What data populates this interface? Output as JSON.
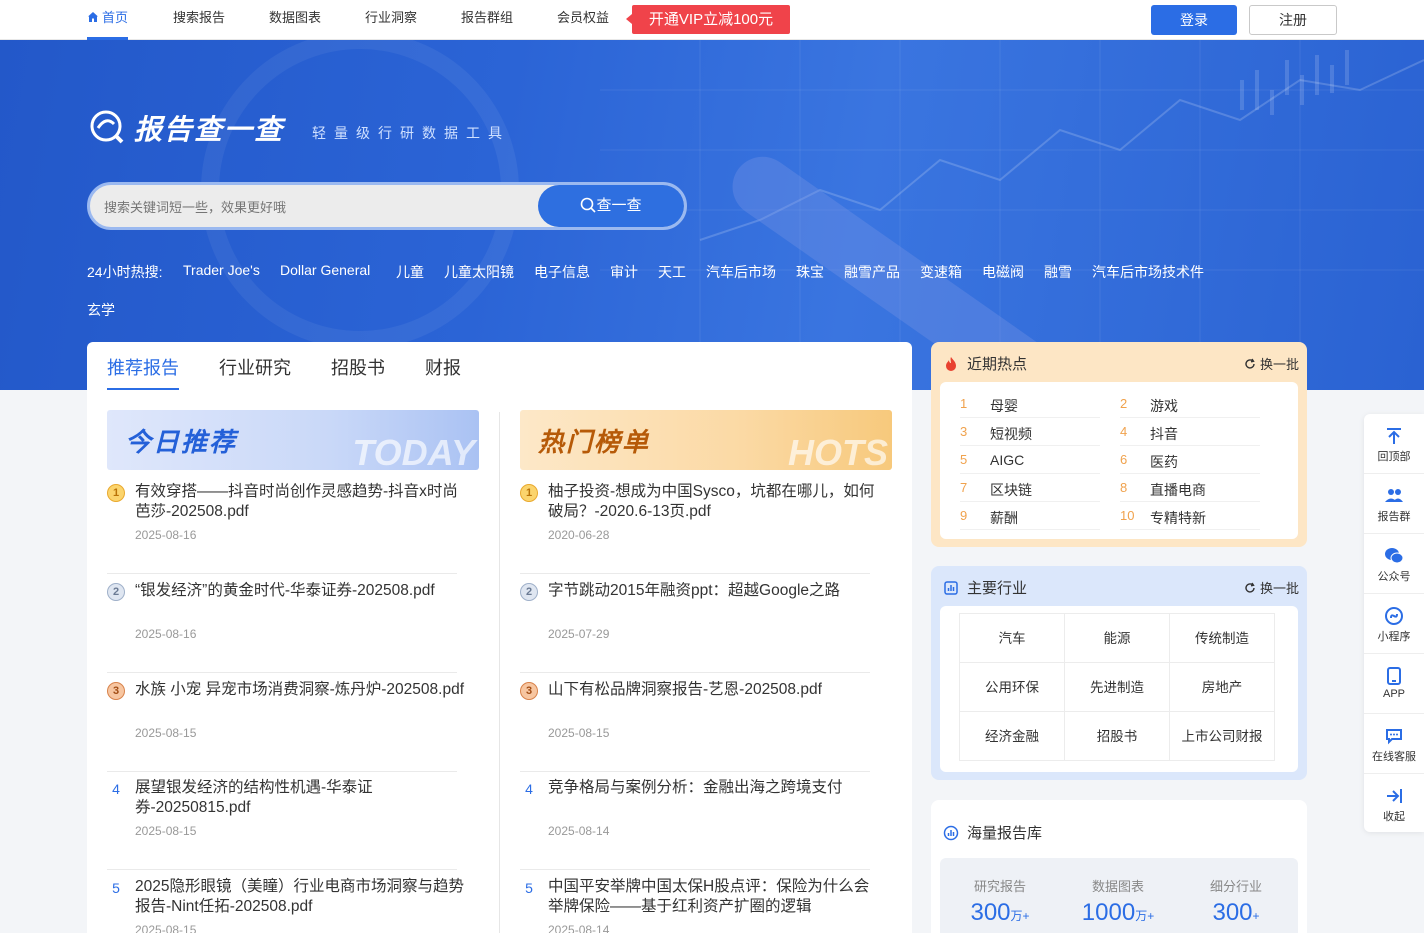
{
  "nav": {
    "items": [
      {
        "label": "首页",
        "active": true
      },
      {
        "label": "搜索报告"
      },
      {
        "label": "数据图表"
      },
      {
        "label": "行业洞察"
      },
      {
        "label": "报告群组"
      },
      {
        "label": "会员权益"
      }
    ],
    "vip_label": "开通VIP立减100元",
    "login_label": "登录",
    "register_label": "注册"
  },
  "hero": {
    "logo_text": "报告查一查",
    "logo_subtitle": "轻量级行研数据工具",
    "search_placeholder": "搜索关键词短一些，效果更好哦",
    "search_button": "查一查",
    "hot_label": "24小时热搜:",
    "hot_keywords": [
      "Trader Joe's",
      "Dollar General",
      "儿童",
      "儿童太阳镜",
      "电子信息",
      "审计",
      "天工",
      "汽车后市场",
      "珠宝",
      "融雪产品",
      "变速箱",
      "电磁阀",
      "融雪",
      "汽车后市场技术件",
      "玄学"
    ]
  },
  "main": {
    "tabs": [
      "推荐报告",
      "行业研究",
      "招股书",
      "财报"
    ],
    "today": {
      "title": "今日推荐",
      "en": "TODAY",
      "items": [
        {
          "rank": "1",
          "title": "有效穿搭——抖音时尚创作灵感趋势-抖音x时尚芭莎-202508.pdf",
          "date": "2025-08-16"
        },
        {
          "rank": "2",
          "title": "“银发经济”的黄金时代-华泰证券-202508.pdf",
          "date": "2025-08-16"
        },
        {
          "rank": "3",
          "title": "水族 小宠 异宠市场消费洞察-炼丹炉-202508.pdf",
          "date": "2025-08-15"
        },
        {
          "rank": "4",
          "title": "展望银发经济的结构性机遇-华泰证券-20250815.pdf",
          "date": "2025-08-15"
        },
        {
          "rank": "5",
          "title": "2025隐形眼镜（美瞳）行业电商市场洞察与趋势报告-Nint任拓-202508.pdf",
          "date": "2025-08-15"
        }
      ]
    },
    "hots": {
      "title": "热门榜单",
      "en": "HOTS",
      "items": [
        {
          "rank": "1",
          "title": "柚子投资-想成为中国Sysco，坑都在哪儿，如何破局？-2020.6-13页.pdf",
          "date": "2020-06-28"
        },
        {
          "rank": "2",
          "title": "字节跳动2015年融资ppt：超越Google之路",
          "date": "2025-07-29"
        },
        {
          "rank": "3",
          "title": "山下有松品牌洞察报告-艺恩-202508.pdf",
          "date": "2025-08-15"
        },
        {
          "rank": "4",
          "title": "竞争格局与案例分析：金融出海之跨境支付",
          "date": "2025-08-14"
        },
        {
          "rank": "5",
          "title": "中国平安举牌中国太保H股点评：保险为什么会举牌保险——基于红利资产扩圈的逻辑",
          "date": "2025-08-14"
        }
      ]
    }
  },
  "hot_topics": {
    "title": "近期热点",
    "refresh": "换一批",
    "items": [
      {
        "num": "1",
        "word": "母婴"
      },
      {
        "num": "2",
        "word": "游戏"
      },
      {
        "num": "3",
        "word": "短视频"
      },
      {
        "num": "4",
        "word": "抖音"
      },
      {
        "num": "5",
        "word": "AIGC"
      },
      {
        "num": "6",
        "word": "医药"
      },
      {
        "num": "7",
        "word": "区块链"
      },
      {
        "num": "8",
        "word": "直播电商"
      },
      {
        "num": "9",
        "word": "薪酬"
      },
      {
        "num": "10",
        "word": "专精特新"
      }
    ]
  },
  "industries": {
    "title": "主要行业",
    "refresh": "换一批",
    "items": [
      "汽车",
      "能源",
      "传统制造",
      "公用环保",
      "先进制造",
      "房地产",
      "经济金融",
      "招股书",
      "上市公司财报"
    ]
  },
  "library": {
    "title": "海量报告库",
    "stats": [
      {
        "label": "研究报告",
        "value": "300",
        "unit": "万+"
      },
      {
        "label": "数据图表",
        "value": "1000",
        "unit": "万+"
      },
      {
        "label": "细分行业",
        "value": "300",
        "unit": "+"
      }
    ]
  },
  "sidebar": {
    "items": [
      "回顶部",
      "报告群",
      "公众号",
      "小程序",
      "APP",
      "在线客服",
      "收起"
    ]
  },
  "colors": {
    "primary": "#2b6de5",
    "vip": "#f0434a",
    "hot_card": "#fde6c5",
    "industry_card": "#dbe7fb"
  }
}
